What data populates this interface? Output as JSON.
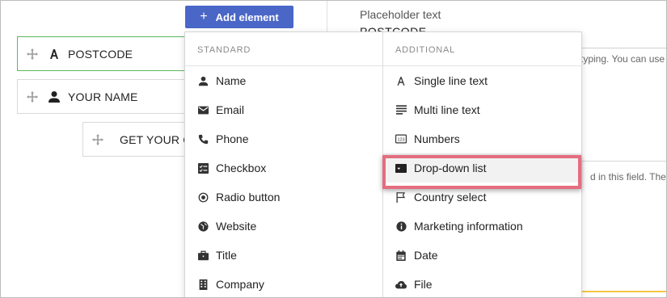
{
  "toolbar": {
    "add_element_label": "Add element"
  },
  "canvas": {
    "fields": [
      {
        "label": "POSTCODE",
        "icon": "text-a-icon",
        "selected": true
      },
      {
        "label": "YOUR NAME",
        "icon": "person-icon",
        "selected": false
      },
      {
        "label": "GET YOUR C",
        "icon": "none",
        "selected": false
      }
    ]
  },
  "settings": {
    "placeholder_label": "Placeholder text",
    "placeholder_value": "POSTCODE",
    "snippet_1": "typing. You can use",
    "snippet_2": "d in this field. The r"
  },
  "menu": {
    "standard_heading": "STANDARD",
    "additional_heading": "ADDITIONAL",
    "standard": [
      {
        "label": "Name",
        "icon": "person-icon"
      },
      {
        "label": "Email",
        "icon": "envelope-icon"
      },
      {
        "label": "Phone",
        "icon": "phone-icon"
      },
      {
        "label": "Checkbox",
        "icon": "checklist-icon"
      },
      {
        "label": "Radio button",
        "icon": "radio-icon"
      },
      {
        "label": "Website",
        "icon": "globe-icon"
      },
      {
        "label": "Title",
        "icon": "briefcase-icon"
      },
      {
        "label": "Company",
        "icon": "building-icon"
      }
    ],
    "additional": [
      {
        "label": "Single line text",
        "icon": "text-a-icon"
      },
      {
        "label": "Multi line text",
        "icon": "multiline-icon"
      },
      {
        "label": "Numbers",
        "icon": "numbers-icon"
      },
      {
        "label": "Drop-down list",
        "icon": "dropdown-icon",
        "highlighted": true
      },
      {
        "label": "Country select",
        "icon": "flag-icon"
      },
      {
        "label": "Marketing information",
        "icon": "info-icon"
      },
      {
        "label": "Date",
        "icon": "calendar-icon"
      },
      {
        "label": "File",
        "icon": "cloud-upload-icon"
      }
    ]
  },
  "colors": {
    "primary": "#4a67c7",
    "selected_border": "#5cb85c",
    "highlight": "#e46d80"
  }
}
